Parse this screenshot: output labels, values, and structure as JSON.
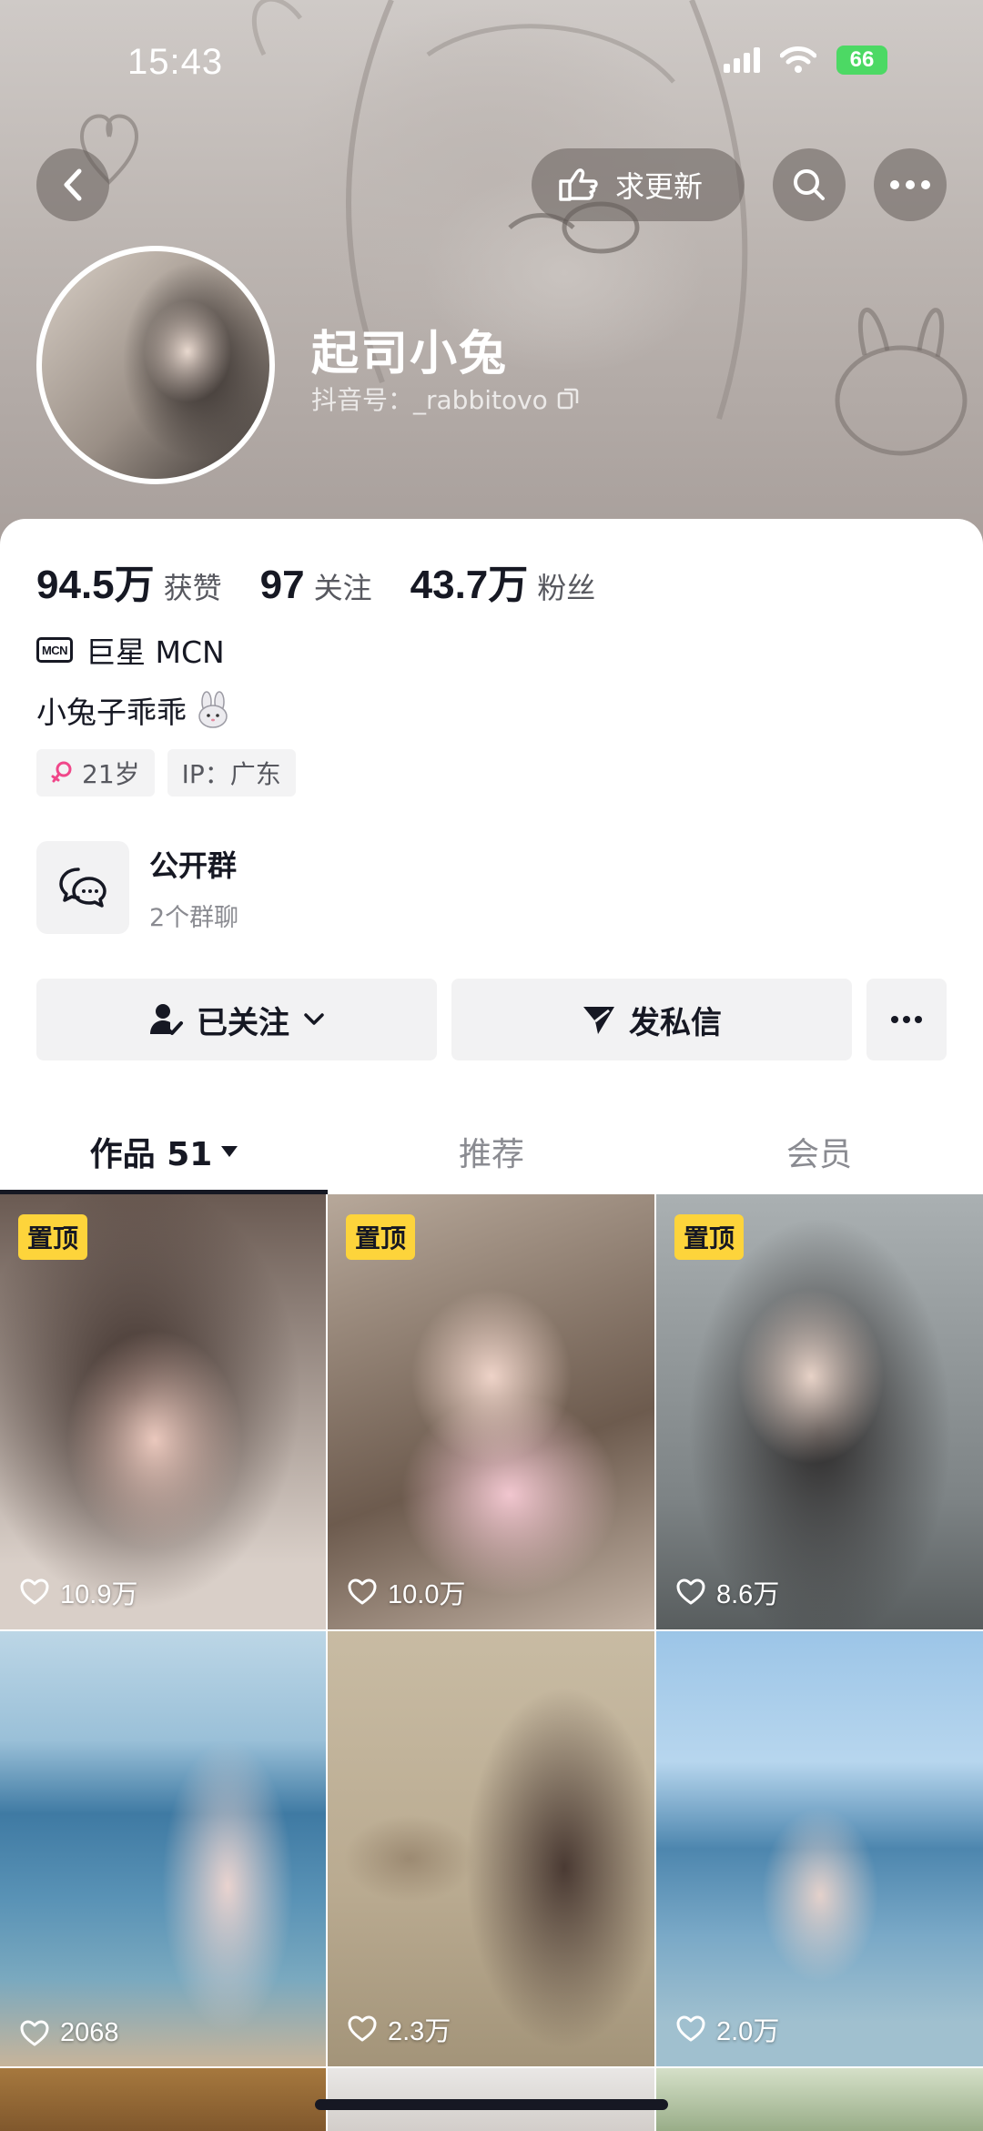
{
  "status_bar": {
    "time": "15:43",
    "battery": "66"
  },
  "header": {
    "request_update_label": "求更新",
    "display_name": "起司小兔",
    "douyin_id": "抖音号：_rabbitovo"
  },
  "stats": [
    {
      "value": "94.5万",
      "label": "获赞"
    },
    {
      "value": "97",
      "label": "关注"
    },
    {
      "value": "43.7万",
      "label": "粉丝"
    }
  ],
  "mcn": {
    "badge": "MCN",
    "name": "巨星 MCN"
  },
  "bio": "小兔子乖乖",
  "tags": {
    "age": "21岁",
    "ip": "IP：广东"
  },
  "group": {
    "title": "公开群",
    "subtitle": "2个群聊"
  },
  "actions": {
    "following_label": "已关注",
    "message_label": "发私信"
  },
  "tabs": [
    {
      "label": "作品 51"
    },
    {
      "label": "推荐"
    },
    {
      "label": "会员"
    }
  ],
  "videos": [
    {
      "pinned_label": "置顶",
      "likes": "10.9万"
    },
    {
      "pinned_label": "置顶",
      "likes": "10.0万"
    },
    {
      "pinned_label": "置顶",
      "likes": "8.6万"
    },
    {
      "likes": "2068"
    },
    {
      "likes": "2.3万"
    },
    {
      "likes": "2.0万"
    }
  ],
  "icons": {
    "back": "back-arrow-icon",
    "request_update": "hand-pointing-icon",
    "search": "search-icon",
    "more": "more-dots-icon",
    "copy": "copy-icon",
    "female": "female-icon",
    "chat_group": "chat-bubbles-icon",
    "followed_person": "person-check-icon",
    "send": "paper-plane-icon",
    "heart": "heart-outline-icon"
  }
}
